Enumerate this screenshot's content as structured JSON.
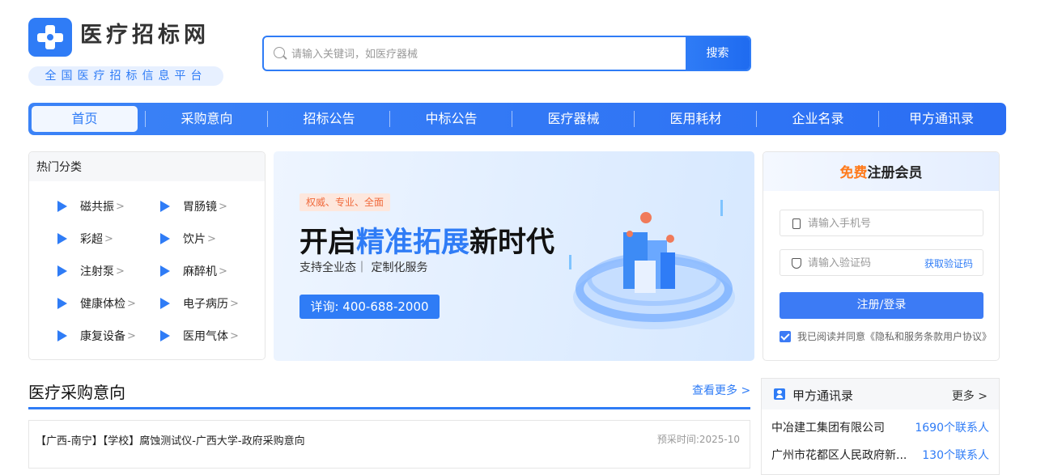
{
  "logo": {
    "title": "医疗招标网",
    "subtitle": "全国医疗招标信息平台"
  },
  "search": {
    "placeholder": "请输入关键词，如医疗器械",
    "button": "搜索"
  },
  "nav": [
    {
      "label": "首页",
      "active": true
    },
    {
      "label": "采购意向"
    },
    {
      "label": "招标公告"
    },
    {
      "label": "中标公告"
    },
    {
      "label": "医疗器械"
    },
    {
      "label": "医用耗材"
    },
    {
      "label": "企业名录"
    },
    {
      "label": "甲方通讯录"
    }
  ],
  "hot": {
    "title": "热门分类",
    "items": [
      "磁共振",
      "胃肠镜",
      "彩超",
      "饮片",
      "注射泵",
      "麻醉机",
      "健康体检",
      "电子病历",
      "康复设备",
      "医用气体"
    ]
  },
  "banner": {
    "tag": "权威、专业、全面",
    "headline_a": "开启",
    "headline_b": "精准拓展",
    "headline_c": "新时代",
    "subline": "支持全业态｜ 定制化服务",
    "hotline": "详询: 400-688-2000"
  },
  "register": {
    "title_free": "免费",
    "title_rest": "注册会员",
    "phone_placeholder": "请输入手机号",
    "code_placeholder": "请输入验证码",
    "get_code": "获取验证码",
    "submit": "注册/登录",
    "agree": "我已阅读并同意《隐私和服务条款用户协议》"
  },
  "procurement": {
    "title": "医疗采购意向",
    "more": "查看更多 >",
    "rows": [
      {
        "title": "【广西-南宁】【学校】腐蚀测试仪-广西大学-政府采购意向",
        "date": "预采时间:2025-10"
      }
    ]
  },
  "contacts": {
    "title": "甲方通讯录",
    "more": "更多 >",
    "rows": [
      {
        "name": "中冶建工集团有限公司",
        "count": "1690个联系人"
      },
      {
        "name": "广州市花都区人民政府新...",
        "count": "130个联系人"
      }
    ]
  },
  "colors": {
    "primary": "#2f7cf6",
    "accent_orange": "#ff7a1a"
  }
}
